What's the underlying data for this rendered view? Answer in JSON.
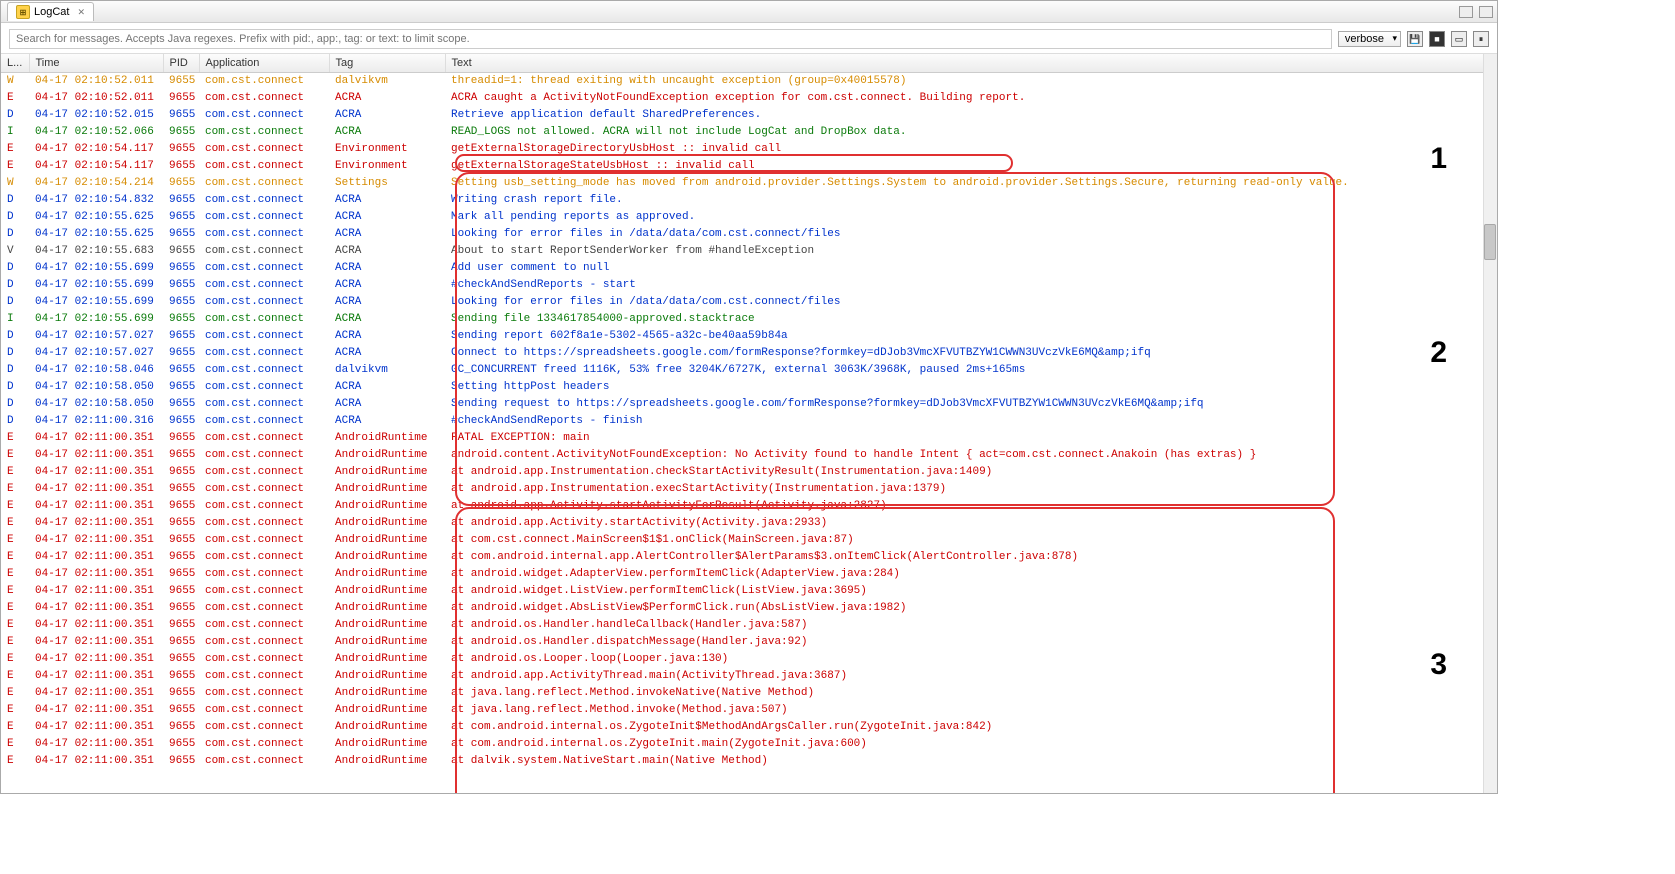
{
  "header": {
    "tab_title": "LogCat",
    "tab_close_glyph": "✕"
  },
  "search": {
    "placeholder": "Search for messages. Accepts Java regexes. Prefix with pid:, app:, tag: or text: to limit scope."
  },
  "filter": {
    "value": "verbose"
  },
  "columns": {
    "level": "L...",
    "time": "Time",
    "pid": "PID",
    "app": "Application",
    "tag": "Tag",
    "text": "Text"
  },
  "annotations": {
    "n1": "1",
    "n2": "2",
    "n3": "3"
  },
  "rows": [
    {
      "lvl": "W",
      "time": "04-17 02:10:52.011",
      "pid": "9655",
      "app": "com.cst.connect",
      "tag": "dalvikvm",
      "text": "threadid=1: thread exiting with uncaught exception (group=0x40015578)"
    },
    {
      "lvl": "E",
      "time": "04-17 02:10:52.011",
      "pid": "9655",
      "app": "com.cst.connect",
      "tag": "ACRA",
      "text": "ACRA caught a ActivityNotFoundException exception for com.cst.connect. Building report."
    },
    {
      "lvl": "D",
      "time": "04-17 02:10:52.015",
      "pid": "9655",
      "app": "com.cst.connect",
      "tag": "ACRA",
      "text": "Retrieve application default SharedPreferences."
    },
    {
      "lvl": "I",
      "time": "04-17 02:10:52.066",
      "pid": "9655",
      "app": "com.cst.connect",
      "tag": "ACRA",
      "text": "READ_LOGS not allowed. ACRA will not include LogCat and DropBox data."
    },
    {
      "lvl": "E",
      "time": "04-17 02:10:54.117",
      "pid": "9655",
      "app": "com.cst.connect",
      "tag": "Environment",
      "text": "getExternalStorageDirectoryUsbHost :: invalid call"
    },
    {
      "lvl": "E",
      "time": "04-17 02:10:54.117",
      "pid": "9655",
      "app": "com.cst.connect",
      "tag": "Environment",
      "text": "getExternalStorageStateUsbHost :: invalid call"
    },
    {
      "lvl": "W",
      "time": "04-17 02:10:54.214",
      "pid": "9655",
      "app": "com.cst.connect",
      "tag": "Settings",
      "text": "Setting usb_setting_mode has moved from android.provider.Settings.System to android.provider.Settings.Secure, returning read-only value."
    },
    {
      "lvl": "D",
      "time": "04-17 02:10:54.832",
      "pid": "9655",
      "app": "com.cst.connect",
      "tag": "ACRA",
      "text": "Writing crash report file."
    },
    {
      "lvl": "D",
      "time": "04-17 02:10:55.625",
      "pid": "9655",
      "app": "com.cst.connect",
      "tag": "ACRA",
      "text": "Mark all pending reports as approved."
    },
    {
      "lvl": "D",
      "time": "04-17 02:10:55.625",
      "pid": "9655",
      "app": "com.cst.connect",
      "tag": "ACRA",
      "text": "Looking for error files in /data/data/com.cst.connect/files"
    },
    {
      "lvl": "V",
      "time": "04-17 02:10:55.683",
      "pid": "9655",
      "app": "com.cst.connect",
      "tag": "ACRA",
      "text": "About to start ReportSenderWorker from #handleException"
    },
    {
      "lvl": "D",
      "time": "04-17 02:10:55.699",
      "pid": "9655",
      "app": "com.cst.connect",
      "tag": "ACRA",
      "text": "Add user comment to null"
    },
    {
      "lvl": "D",
      "time": "04-17 02:10:55.699",
      "pid": "9655",
      "app": "com.cst.connect",
      "tag": "ACRA",
      "text": "#checkAndSendReports - start"
    },
    {
      "lvl": "D",
      "time": "04-17 02:10:55.699",
      "pid": "9655",
      "app": "com.cst.connect",
      "tag": "ACRA",
      "text": "Looking for error files in /data/data/com.cst.connect/files"
    },
    {
      "lvl": "I",
      "time": "04-17 02:10:55.699",
      "pid": "9655",
      "app": "com.cst.connect",
      "tag": "ACRA",
      "text": "Sending file 1334617854000-approved.stacktrace"
    },
    {
      "lvl": "D",
      "time": "04-17 02:10:57.027",
      "pid": "9655",
      "app": "com.cst.connect",
      "tag": "ACRA",
      "text": "Sending report 602f8a1e-5302-4565-a32c-be40aa59b84a"
    },
    {
      "lvl": "D",
      "time": "04-17 02:10:57.027",
      "pid": "9655",
      "app": "com.cst.connect",
      "tag": "ACRA",
      "text": "Connect to https://spreadsheets.google.com/formResponse?formkey=dDJob3VmcXFVUTBZYW1CWWN3UVczVkE6MQ&amp;ifq"
    },
    {
      "lvl": "D",
      "time": "04-17 02:10:58.046",
      "pid": "9655",
      "app": "com.cst.connect",
      "tag": "dalvikvm",
      "text": "GC_CONCURRENT freed 1116K, 53% free 3204K/6727K, external 3063K/3968K, paused 2ms+165ms"
    },
    {
      "lvl": "D",
      "time": "04-17 02:10:58.050",
      "pid": "9655",
      "app": "com.cst.connect",
      "tag": "ACRA",
      "text": "Setting httpPost headers"
    },
    {
      "lvl": "D",
      "time": "04-17 02:10:58.050",
      "pid": "9655",
      "app": "com.cst.connect",
      "tag": "ACRA",
      "text": "Sending request to https://spreadsheets.google.com/formResponse?formkey=dDJob3VmcXFVUTBZYW1CWWN3UVczVkE6MQ&amp;ifq"
    },
    {
      "lvl": "D",
      "time": "04-17 02:11:00.316",
      "pid": "9655",
      "app": "com.cst.connect",
      "tag": "ACRA",
      "text": "#checkAndSendReports - finish"
    },
    {
      "lvl": "E",
      "time": "04-17 02:11:00.351",
      "pid": "9655",
      "app": "com.cst.connect",
      "tag": "AndroidRuntime",
      "text": "FATAL EXCEPTION: main"
    },
    {
      "lvl": "E",
      "time": "04-17 02:11:00.351",
      "pid": "9655",
      "app": "com.cst.connect",
      "tag": "AndroidRuntime",
      "text": "android.content.ActivityNotFoundException: No Activity found to handle Intent { act=com.cst.connect.Anakoin (has extras) }"
    },
    {
      "lvl": "E",
      "time": "04-17 02:11:00.351",
      "pid": "9655",
      "app": "com.cst.connect",
      "tag": "AndroidRuntime",
      "text": "at android.app.Instrumentation.checkStartActivityResult(Instrumentation.java:1409)"
    },
    {
      "lvl": "E",
      "time": "04-17 02:11:00.351",
      "pid": "9655",
      "app": "com.cst.connect",
      "tag": "AndroidRuntime",
      "text": "at android.app.Instrumentation.execStartActivity(Instrumentation.java:1379)"
    },
    {
      "lvl": "E",
      "time": "04-17 02:11:00.351",
      "pid": "9655",
      "app": "com.cst.connect",
      "tag": "AndroidRuntime",
      "text": "at android.app.Activity.startActivityForResult(Activity.java:2827)"
    },
    {
      "lvl": "E",
      "time": "04-17 02:11:00.351",
      "pid": "9655",
      "app": "com.cst.connect",
      "tag": "AndroidRuntime",
      "text": "at android.app.Activity.startActivity(Activity.java:2933)"
    },
    {
      "lvl": "E",
      "time": "04-17 02:11:00.351",
      "pid": "9655",
      "app": "com.cst.connect",
      "tag": "AndroidRuntime",
      "text": "at com.cst.connect.MainScreen$1$1.onClick(MainScreen.java:87)"
    },
    {
      "lvl": "E",
      "time": "04-17 02:11:00.351",
      "pid": "9655",
      "app": "com.cst.connect",
      "tag": "AndroidRuntime",
      "text": "at com.android.internal.app.AlertController$AlertParams$3.onItemClick(AlertController.java:878)"
    },
    {
      "lvl": "E",
      "time": "04-17 02:11:00.351",
      "pid": "9655",
      "app": "com.cst.connect",
      "tag": "AndroidRuntime",
      "text": "at android.widget.AdapterView.performItemClick(AdapterView.java:284)"
    },
    {
      "lvl": "E",
      "time": "04-17 02:11:00.351",
      "pid": "9655",
      "app": "com.cst.connect",
      "tag": "AndroidRuntime",
      "text": "at android.widget.ListView.performItemClick(ListView.java:3695)"
    },
    {
      "lvl": "E",
      "time": "04-17 02:11:00.351",
      "pid": "9655",
      "app": "com.cst.connect",
      "tag": "AndroidRuntime",
      "text": "at android.widget.AbsListView$PerformClick.run(AbsListView.java:1982)"
    },
    {
      "lvl": "E",
      "time": "04-17 02:11:00.351",
      "pid": "9655",
      "app": "com.cst.connect",
      "tag": "AndroidRuntime",
      "text": "at android.os.Handler.handleCallback(Handler.java:587)"
    },
    {
      "lvl": "E",
      "time": "04-17 02:11:00.351",
      "pid": "9655",
      "app": "com.cst.connect",
      "tag": "AndroidRuntime",
      "text": "at android.os.Handler.dispatchMessage(Handler.java:92)"
    },
    {
      "lvl": "E",
      "time": "04-17 02:11:00.351",
      "pid": "9655",
      "app": "com.cst.connect",
      "tag": "AndroidRuntime",
      "text": "at android.os.Looper.loop(Looper.java:130)"
    },
    {
      "lvl": "E",
      "time": "04-17 02:11:00.351",
      "pid": "9655",
      "app": "com.cst.connect",
      "tag": "AndroidRuntime",
      "text": "at android.app.ActivityThread.main(ActivityThread.java:3687)"
    },
    {
      "lvl": "E",
      "time": "04-17 02:11:00.351",
      "pid": "9655",
      "app": "com.cst.connect",
      "tag": "AndroidRuntime",
      "text": "at java.lang.reflect.Method.invokeNative(Native Method)"
    },
    {
      "lvl": "E",
      "time": "04-17 02:11:00.351",
      "pid": "9655",
      "app": "com.cst.connect",
      "tag": "AndroidRuntime",
      "text": "at java.lang.reflect.Method.invoke(Method.java:507)"
    },
    {
      "lvl": "E",
      "time": "04-17 02:11:00.351",
      "pid": "9655",
      "app": "com.cst.connect",
      "tag": "AndroidRuntime",
      "text": "at com.android.internal.os.ZygoteInit$MethodAndArgsCaller.run(ZygoteInit.java:842)"
    },
    {
      "lvl": "E",
      "time": "04-17 02:11:00.351",
      "pid": "9655",
      "app": "com.cst.connect",
      "tag": "AndroidRuntime",
      "text": "at com.android.internal.os.ZygoteInit.main(ZygoteInit.java:600)"
    },
    {
      "lvl": "E",
      "time": "04-17 02:11:00.351",
      "pid": "9655",
      "app": "com.cst.connect",
      "tag": "AndroidRuntime",
      "text": "at dalvik.system.NativeStart.main(Native Method)"
    }
  ]
}
